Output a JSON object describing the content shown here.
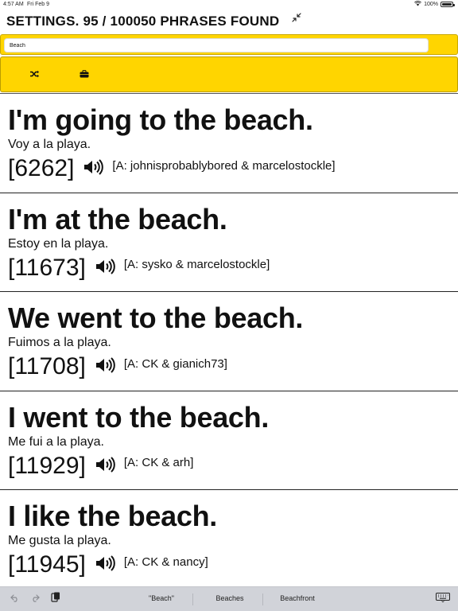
{
  "status": {
    "time": "4:57 AM",
    "date": "Fri Feb 9",
    "battery": "100%",
    "battery_level": 1.0
  },
  "header": {
    "title": "SETTINGS. 95 / 100050 PHRASES FOUND"
  },
  "search": {
    "value": "Beach",
    "placeholder": ""
  },
  "toolbar": {
    "shuffle_icon": "shuffle-icon",
    "briefcase_icon": "briefcase-icon"
  },
  "results": [
    {
      "phrase": "I'm going to the beach.",
      "translation": "Voy a la playa.",
      "id": "[6262]",
      "attribution": "[A: johnisprobablybored & marcelostockle]"
    },
    {
      "phrase": "I'm at the beach.",
      "translation": "Estoy en la playa.",
      "id": "[11673]",
      "attribution": "[A: sysko & marcelostockle]"
    },
    {
      "phrase": "We went to the beach.",
      "translation": "Fuimos a la playa.",
      "id": "[11708]",
      "attribution": "[A: CK & gianich73]"
    },
    {
      "phrase": "I went to the beach.",
      "translation": "Me fui a la playa.",
      "id": "[11929]",
      "attribution": "[A: CK & arh]"
    },
    {
      "phrase": "I like the beach.",
      "translation": "Me gusta la playa.",
      "id": "[11945]",
      "attribution": "[A: CK & nancy]"
    }
  ],
  "keyboard_bar": {
    "suggestions": [
      "\"Beach\"",
      "Beaches",
      "Beachfront"
    ]
  },
  "colors": {
    "accent_yellow": "#ffd500",
    "keyboard_bar": "#d1d3d9"
  }
}
